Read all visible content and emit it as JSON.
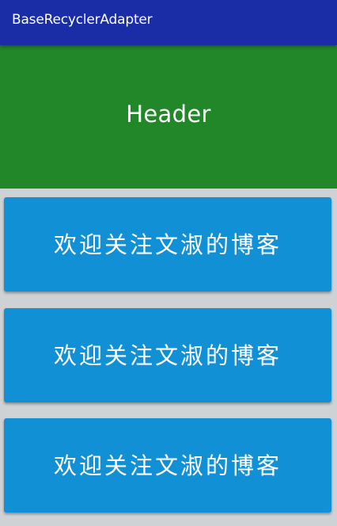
{
  "app_bar": {
    "title": "BaseRecyclerAdapter"
  },
  "header": {
    "label": "Header"
  },
  "list": {
    "items": [
      {
        "text": "欢迎关注文淑的博客"
      },
      {
        "text": "欢迎关注文淑的博客"
      },
      {
        "text": "欢迎关注文淑的博客"
      }
    ]
  },
  "colors": {
    "app_bar": "#1a2da6",
    "header": "#218728",
    "card": "#1290d5",
    "background": "#cfd2d4",
    "text": "#ffffff"
  }
}
